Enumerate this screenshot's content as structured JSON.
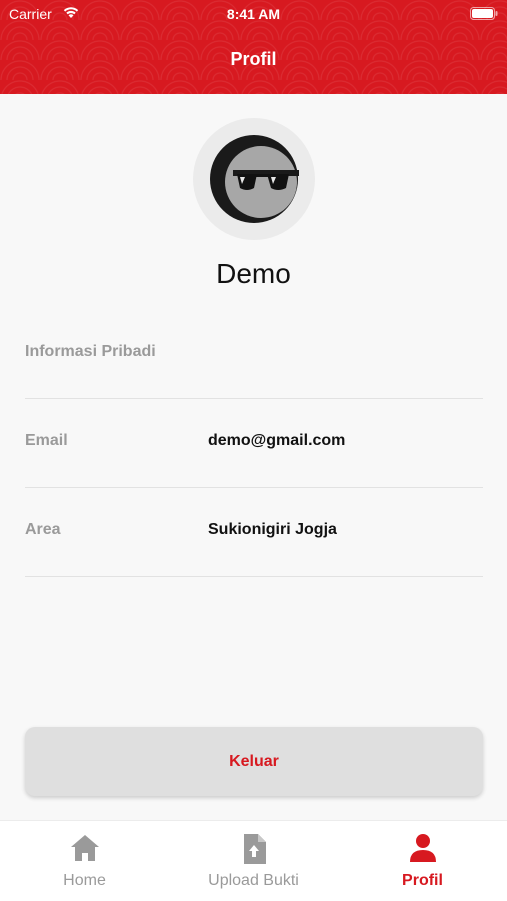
{
  "status_bar": {
    "carrier": "Carrier",
    "time": "8:41 AM"
  },
  "header": {
    "title": "Profil"
  },
  "profile": {
    "name": "Demo",
    "section_title": "Informasi Pribadi",
    "fields": [
      {
        "label": "Email",
        "value": "demo@gmail.com"
      },
      {
        "label": "Area",
        "value": "Sukionigiri Jogja"
      }
    ]
  },
  "actions": {
    "logout_label": "Keluar"
  },
  "tabbar": {
    "tabs": [
      {
        "label": "Home",
        "icon": "home-icon",
        "active": false
      },
      {
        "label": "Upload Bukti",
        "icon": "upload-file-icon",
        "active": false
      },
      {
        "label": "Profil",
        "icon": "person-icon",
        "active": true
      }
    ]
  },
  "colors": {
    "brand": "#d71920",
    "background": "#f8f8f8",
    "inactive": "#9a9a9a"
  }
}
